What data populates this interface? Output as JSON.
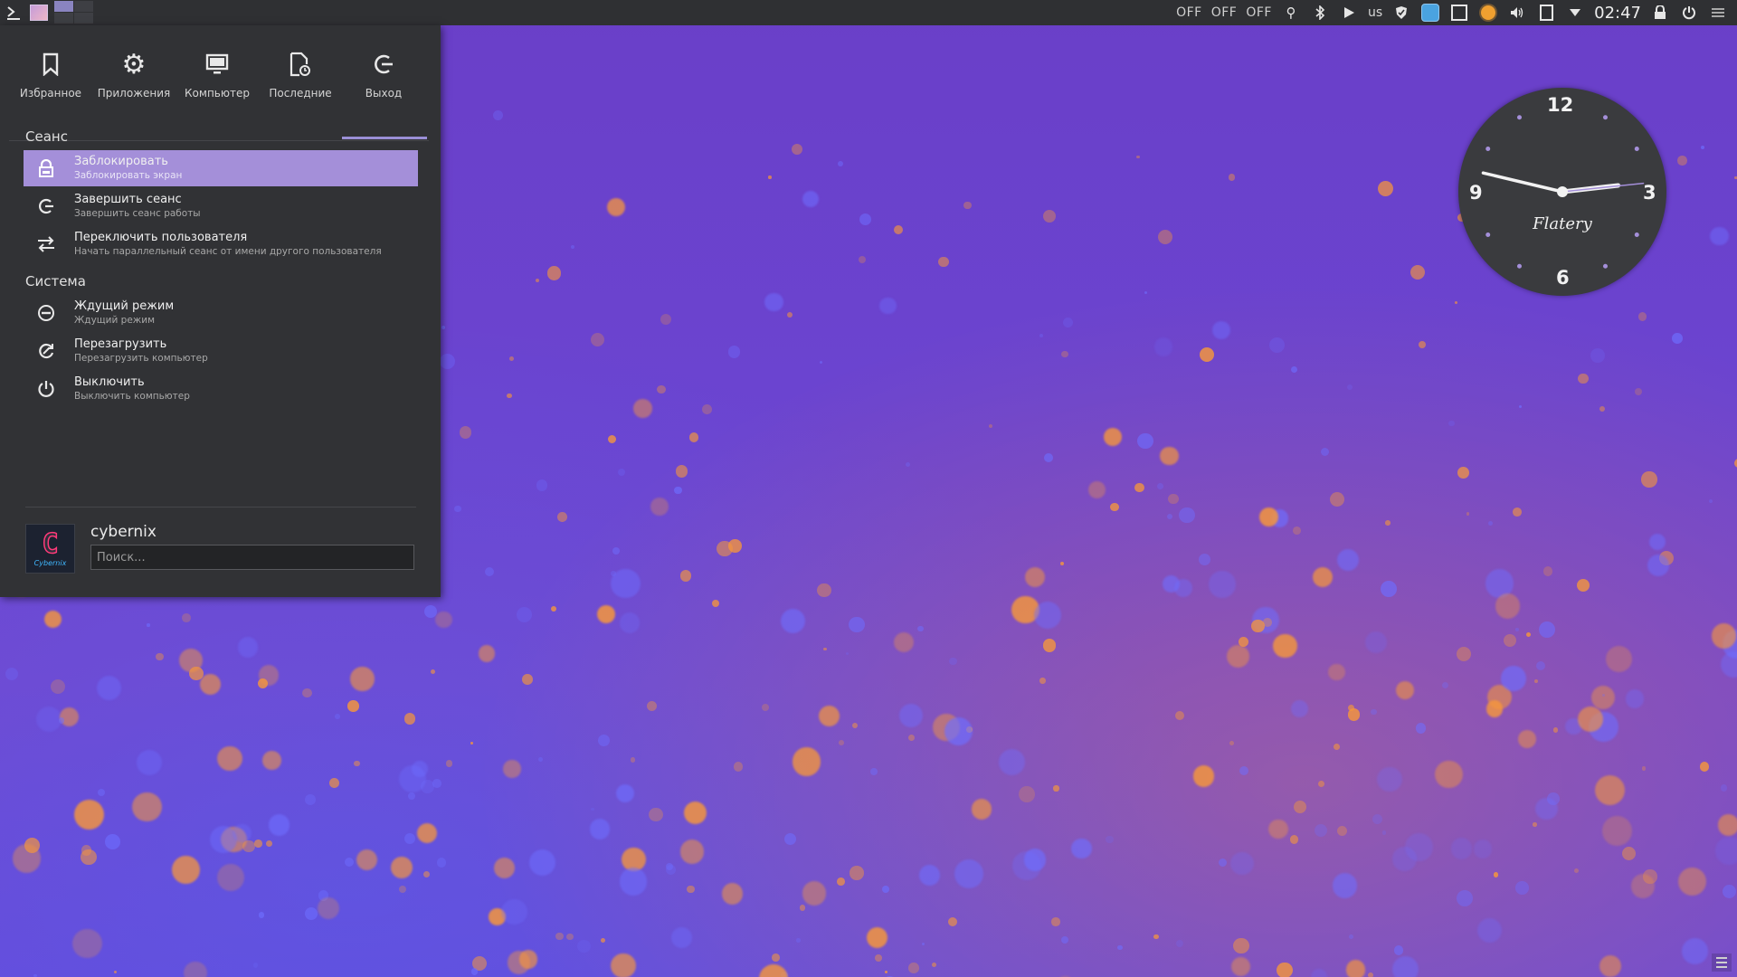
{
  "topbar": {
    "off_labels": [
      "OFF",
      "OFF",
      "OFF"
    ],
    "keyboard_layout": "us",
    "time": "02:47"
  },
  "launcher": {
    "tabs": [
      {
        "label": "Избранное",
        "icon": "bookmark-icon"
      },
      {
        "label": "Приложения",
        "icon": "gear-icon"
      },
      {
        "label": "Компьютер",
        "icon": "monitor-icon"
      },
      {
        "label": "Последние",
        "icon": "recent-document-icon"
      },
      {
        "label": "Выход",
        "icon": "logout-icon"
      }
    ],
    "active_tab": "Выход",
    "sections": [
      {
        "title": "Сеанс",
        "items": [
          {
            "title": "Заблокировать",
            "subtitle": "Заблокировать экран",
            "icon": "lock-icon"
          },
          {
            "title": "Завершить сеанс",
            "subtitle": "Завершить сеанс работы",
            "icon": "logout-icon"
          },
          {
            "title": "Переключить пользователя",
            "subtitle": "Начать параллельный сеанс от имени другого пользователя",
            "icon": "switch-user-icon"
          }
        ]
      },
      {
        "title": "Система",
        "items": [
          {
            "title": "Ждущий режим",
            "subtitle": "Ждущий режим",
            "icon": "suspend-icon"
          },
          {
            "title": "Перезагрузить",
            "subtitle": "Перезагрузить компьютер",
            "icon": "restart-icon"
          },
          {
            "title": "Выключить",
            "subtitle": "Выключить компьютер",
            "icon": "power-icon"
          }
        ]
      }
    ],
    "user": {
      "name": "cybernix",
      "avatar_letter": "C",
      "avatar_caption": "Cybernix"
    },
    "search": {
      "placeholder": "Поиск..."
    }
  },
  "clock_widget": {
    "numbers": [
      "12",
      "3",
      "6",
      "9"
    ],
    "brand": "Flatery",
    "time": {
      "hours": 2,
      "minutes": 47,
      "seconds": 14
    }
  },
  "colors": {
    "accent": "#a48fd9",
    "panel": "#313235",
    "topbar": "#2f3033"
  }
}
